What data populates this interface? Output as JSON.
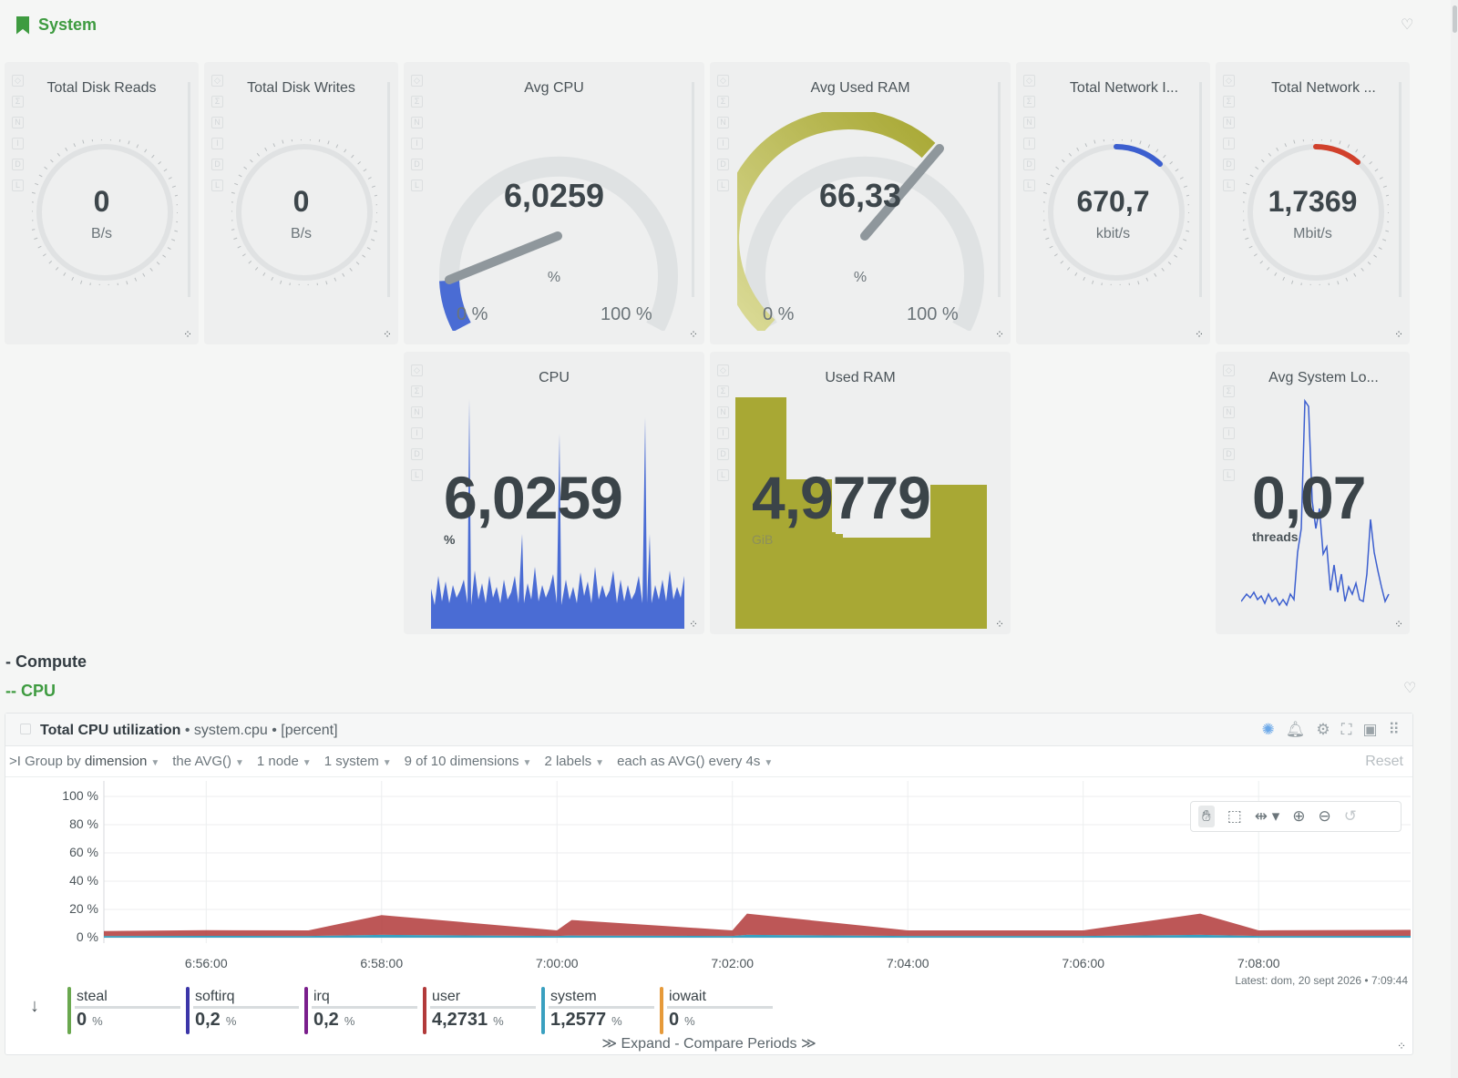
{
  "section": {
    "title": "System"
  },
  "gauges": [
    {
      "title": "Total Disk Reads",
      "value": "0",
      "unit": "B/s"
    },
    {
      "title": "Total Disk Writes",
      "value": "0",
      "unit": "B/s"
    },
    {
      "title": "Avg CPU",
      "value": "6,0259",
      "unit": "%",
      "min": "0 %",
      "max": "100 %"
    },
    {
      "title": "Avg Used RAM",
      "value": "66,33",
      "unit": "%",
      "min": "0 %",
      "max": "100 %"
    },
    {
      "title": "Total Network I...",
      "value": "670,7",
      "unit": "kbit/s"
    },
    {
      "title": "Total Network ...",
      "value": "1,7369",
      "unit": "Mbit/s"
    }
  ],
  "sparks": [
    {
      "title": "CPU",
      "value": "6,0259",
      "unit": "%"
    },
    {
      "title": "Used RAM",
      "value": "4,9779",
      "unit": "GiB"
    },
    {
      "title": "Avg System Lo...",
      "value": "0,07",
      "unit": "threads"
    }
  ],
  "headings": {
    "compute": "- Compute",
    "cpu": "-- CPU"
  },
  "chart": {
    "title": "Total CPU utilization",
    "context": "system.cpu",
    "units": "[percent]",
    "filters": {
      "group_prefix": ">I Group by",
      "group": "dimension",
      "agg": "the AVG()",
      "nodes": "1 node",
      "instances": "1 system",
      "dims": "9 of 10 dimensions",
      "labels": "2 labels",
      "each": "each as AVG() every 4s",
      "reset": "Reset"
    },
    "latest": "Latest: dom, 20 sept 2026 • 7:09:44",
    "expand": "≫ Expand - Compare Periods ≫",
    "legend": [
      {
        "name": "steal",
        "value": "0",
        "unit": "%",
        "color": "#6aa84f"
      },
      {
        "name": "softirq",
        "value": "0,2",
        "unit": "%",
        "color": "#3b35a8"
      },
      {
        "name": "irq",
        "value": "0,2",
        "unit": "%",
        "color": "#7a1e8c"
      },
      {
        "name": "user",
        "value": "4,2731",
        "unit": "%",
        "color": "#b23a3a"
      },
      {
        "name": "system",
        "value": "1,2577",
        "unit": "%",
        "color": "#3aa0c0"
      },
      {
        "name": "iowait",
        "value": "0",
        "unit": "%",
        "color": "#e69a3a"
      }
    ]
  },
  "chart_data": {
    "type": "area",
    "title": "Total CPU utilization",
    "ylabel": "%",
    "ylim": [
      0,
      100
    ],
    "y_ticks": [
      "100 %",
      "80 %",
      "60 %",
      "40 %",
      "20 %",
      "0 %"
    ],
    "x_ticks": [
      "6:56:00",
      "6:58:00",
      "7:00:00",
      "7:02:00",
      "7:04:00",
      "7:06:00",
      "7:08:00"
    ],
    "x": [
      "6:54:50",
      "6:56:00",
      "6:57:10",
      "6:58:00",
      "7:00:00",
      "7:00:10",
      "7:02:00",
      "7:02:10",
      "7:04:00",
      "7:06:00",
      "7:07:20",
      "7:08:00",
      "7:09:44"
    ],
    "series": [
      {
        "name": "user",
        "values": [
          3.5,
          4,
          4,
          14,
          4,
          11,
          4,
          15,
          4,
          4,
          15,
          4,
          4.3
        ]
      },
      {
        "name": "system",
        "values": [
          1.2,
          1.3,
          1.2,
          2,
          1.2,
          1.5,
          1.2,
          2,
          1.2,
          1.2,
          2,
          1.2,
          1.26
        ]
      }
    ]
  }
}
